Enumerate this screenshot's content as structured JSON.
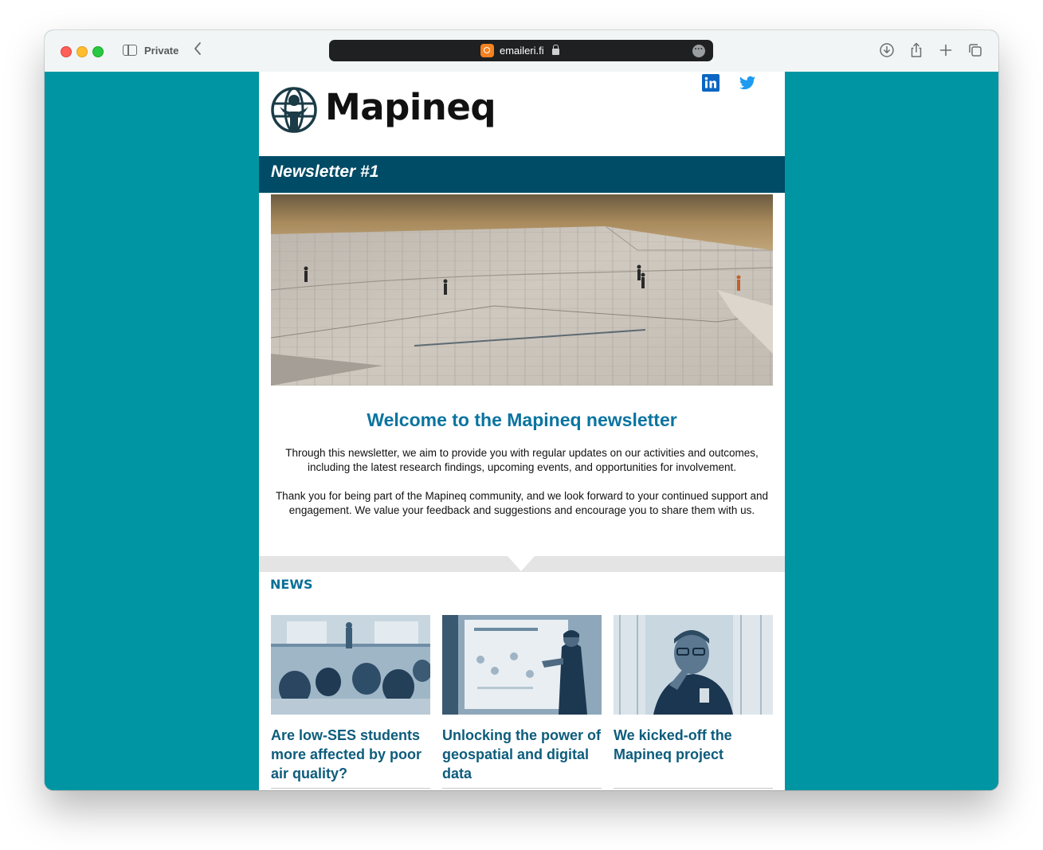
{
  "browser": {
    "mode_label": "Private",
    "url": "emaileri.fi",
    "site_icon": "emaileri-favicon-icon",
    "more_icon": "ellipsis-icon"
  },
  "colors": {
    "page_bg": "#0095a2",
    "banner": "#004b66",
    "headline": "#0a74a0",
    "card_title": "#0d5c7c"
  },
  "email": {
    "brand": "Mapineq",
    "social": [
      "linkedin-icon",
      "twitter-icon"
    ],
    "banner_title": "Newsletter #1",
    "welcome_title": "Welcome to the Mapineq newsletter",
    "paragraph_1": "Through this newsletter, we aim to provide you with regular updates on our activities and outcomes, including the latest research findings, upcoming events, and opportunities for involvement.",
    "paragraph_2": "Thank you for being part of the Mapineq community, and we look forward to your continued support and engagement. We value your feedback and suggestions and encourage you to share them with us.",
    "news_heading": "NEWS",
    "news": [
      {
        "title": "Are low-SES students more affected by poor air quality?"
      },
      {
        "title": "Unlocking the power of geospatial and digital data"
      },
      {
        "title": "We kicked-off the Mapineq project"
      }
    ]
  }
}
